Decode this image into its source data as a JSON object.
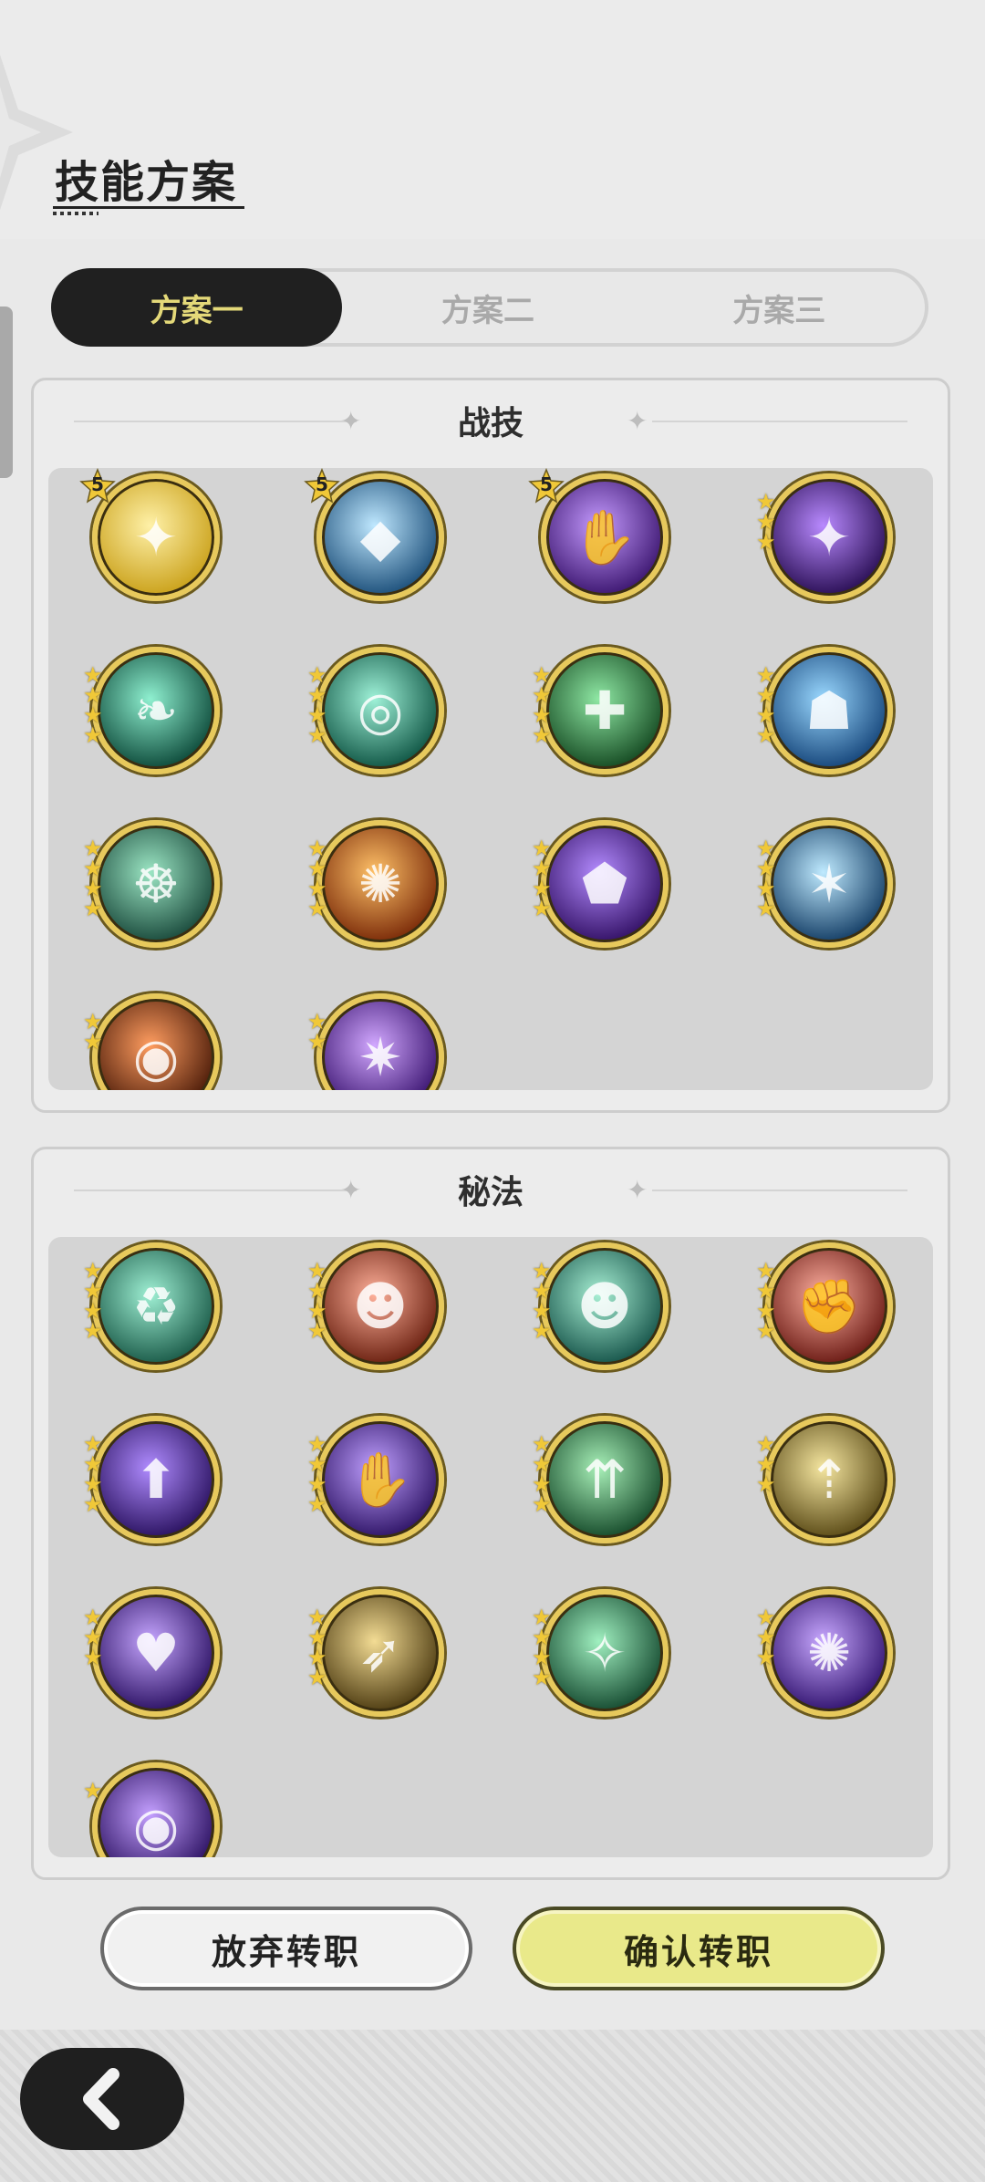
{
  "header": {
    "title": "技能方案"
  },
  "tabs": [
    {
      "label": "方案一",
      "active": true
    },
    {
      "label": "方案二",
      "active": false
    },
    {
      "label": "方案三",
      "active": false
    }
  ],
  "panels": {
    "skills": {
      "title": "战技",
      "items": [
        {
          "icon": "golden-sparkle-icon",
          "stars": 5,
          "star_style": "badge"
        },
        {
          "icon": "ice-crystal-icon",
          "stars": 5,
          "star_style": "badge"
        },
        {
          "icon": "purple-hand-icon",
          "stars": 5,
          "star_style": "badge"
        },
        {
          "icon": "purple-star-burst-icon",
          "stars": 3
        },
        {
          "icon": "wind-leaf-icon",
          "stars": 4
        },
        {
          "icon": "green-vortex-icon",
          "stars": 4
        },
        {
          "icon": "green-plus-heal-icon",
          "stars": 4
        },
        {
          "icon": "blue-spirit-icon",
          "stars": 4
        },
        {
          "icon": "green-meditation-icon",
          "stars": 4
        },
        {
          "icon": "fire-swirl-icon",
          "stars": 4
        },
        {
          "icon": "purple-shield-icon",
          "stars": 4
        },
        {
          "icon": "ice-shatter-icon",
          "stars": 4
        },
        {
          "icon": "fire-vortex-icon",
          "stars": 2
        },
        {
          "icon": "purple-burst-icon",
          "stars": 2
        }
      ]
    },
    "secrets": {
      "title": "秘法",
      "items": [
        {
          "icon": "green-cycle-icon",
          "stars": 4
        },
        {
          "icon": "red-person-icon",
          "stars": 4
        },
        {
          "icon": "green-person-icon",
          "stars": 4
        },
        {
          "icon": "red-fist-icon",
          "stars": 4
        },
        {
          "icon": "purple-uplift-icon",
          "stars": 4
        },
        {
          "icon": "purple-arm-icon",
          "stars": 4
        },
        {
          "icon": "green-pillar-icon",
          "stars": 4
        },
        {
          "icon": "gold-feather-icon",
          "stars": 3
        },
        {
          "icon": "purple-heart-icon",
          "stars": 3
        },
        {
          "icon": "gold-wing-icon",
          "stars": 4
        },
        {
          "icon": "green-sparkle-icon",
          "stars": 4
        },
        {
          "icon": "purple-spiral-icon",
          "stars": 3
        },
        {
          "icon": "purple-eye-icon",
          "stars": 1
        }
      ]
    }
  },
  "buttons": {
    "abandon": "放弃转职",
    "confirm": "确认转职"
  },
  "nav": {
    "back_icon": "chevron-left-icon"
  },
  "colors": {
    "accent_yellow": "#e9e98a",
    "tab_active_bg": "#202020",
    "tab_active_text": "#e4d979",
    "ring_gold": "#e7c95c"
  }
}
